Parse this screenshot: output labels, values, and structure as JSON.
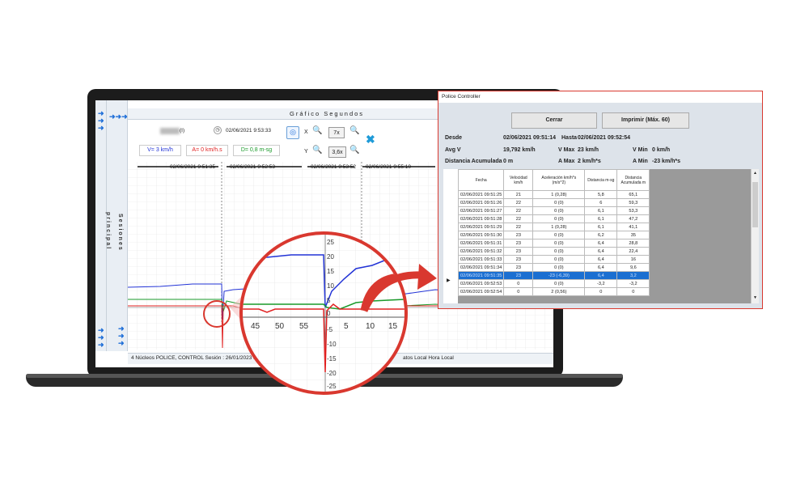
{
  "app": {
    "title": "Gráfico Segundos",
    "sidebar_left_label": "principal",
    "sidebar_right_label": "Sesiones",
    "device_label": "(I)",
    "datetime": "02/06/2021 9:53:33",
    "x_label": "X",
    "y_label": "Y",
    "x_zoom": "7x",
    "y_zoom": "3,6x",
    "legend": {
      "velocity": "V= 3 km/h",
      "acceleration": "A= 0 km/h.s",
      "distance": "D= 0,8 m-sg"
    },
    "time_markers": [
      "02/06/2021 9:51:35",
      "02/06/2021 9:52:53",
      "02/06/2021 9:53:52",
      "02/06/2021 9:55:10"
    ],
    "status_bar": "4 Núcleos   POLICE, CONTROL   Sesión : 26/01/2023 14:59 Contr",
    "status_bar_right": "atos Local   Hora Local",
    "colors": {
      "velocity": "#2233d6",
      "acceleration": "#e02020",
      "distance": "#1a9a2a",
      "accent": "#1f6fd8"
    }
  },
  "magnifier": {
    "x_ticks": [
      "45",
      "50",
      "55",
      "",
      "5",
      "10",
      "15"
    ],
    "y_ticks": [
      "25",
      "20",
      "15",
      "10",
      "5",
      "0",
      "-5",
      "-10",
      "-15",
      "-20",
      "-25"
    ]
  },
  "dialog": {
    "title": "Police Controller",
    "close_label": "Cerrar",
    "print_label": "Imprimir (Máx. 60)",
    "desde_label": "Desde",
    "desde_value": "02/06/2021 09:51:14",
    "hasta_label": "Hasta",
    "hasta_value": "02/06/2021 09:52:54",
    "avg_v_label": "Avg V",
    "avg_v_value": "19,792 km/h",
    "v_max_label": "V Max",
    "v_max_value": "23 km/h",
    "v_min_label": "V Min",
    "v_min_value": "0 km/h",
    "dist_label": "Distancia Acumulada",
    "dist_value": "0 m",
    "a_max_label": "A Max",
    "a_max_value": "2 km/h*s",
    "a_min_label": "A Min",
    "a_min_value": "-23 km/h*s",
    "columns": [
      "Fecha",
      "Velocidad km/h",
      "Aceleración km/h*s (m/s^2)",
      "Distancia m-sg",
      "Distancia Acumulada m"
    ],
    "rows": [
      [
        "02/06/2021 09:51:25",
        "21",
        "1 (0,28)",
        "5,8",
        "65,1"
      ],
      [
        "02/06/2021 09:51:26",
        "22",
        "0 (0)",
        "6",
        "59,3"
      ],
      [
        "02/06/2021 09:51:27",
        "22",
        "0 (0)",
        "6,1",
        "53,3"
      ],
      [
        "02/06/2021 09:51:28",
        "22",
        "0 (0)",
        "6,1",
        "47,2"
      ],
      [
        "02/06/2021 09:51:29",
        "22",
        "1 (0,28)",
        "6,1",
        "41,1"
      ],
      [
        "02/06/2021 09:51:30",
        "23",
        "0 (0)",
        "6,2",
        "35"
      ],
      [
        "02/06/2021 09:51:31",
        "23",
        "0 (0)",
        "6,4",
        "28,8"
      ],
      [
        "02/06/2021 09:51:32",
        "23",
        "0 (0)",
        "6,4",
        "22,4"
      ],
      [
        "02/06/2021 09:51:33",
        "23",
        "0 (0)",
        "6,4",
        "16"
      ],
      [
        "02/06/2021 09:51:34",
        "23",
        "0 (0)",
        "6,4",
        "9,6"
      ],
      [
        "02/06/2021 09:51:35",
        "23",
        "-23 (-6,39)",
        "6,4",
        "3,2"
      ],
      [
        "02/06/2021 09:52:53",
        "0",
        "0 (0)",
        "-3,2",
        "-3,2"
      ],
      [
        "02/06/2021 09:52:54",
        "0",
        "2 (0,56)",
        "0",
        "0"
      ]
    ],
    "selected_row": 10
  }
}
